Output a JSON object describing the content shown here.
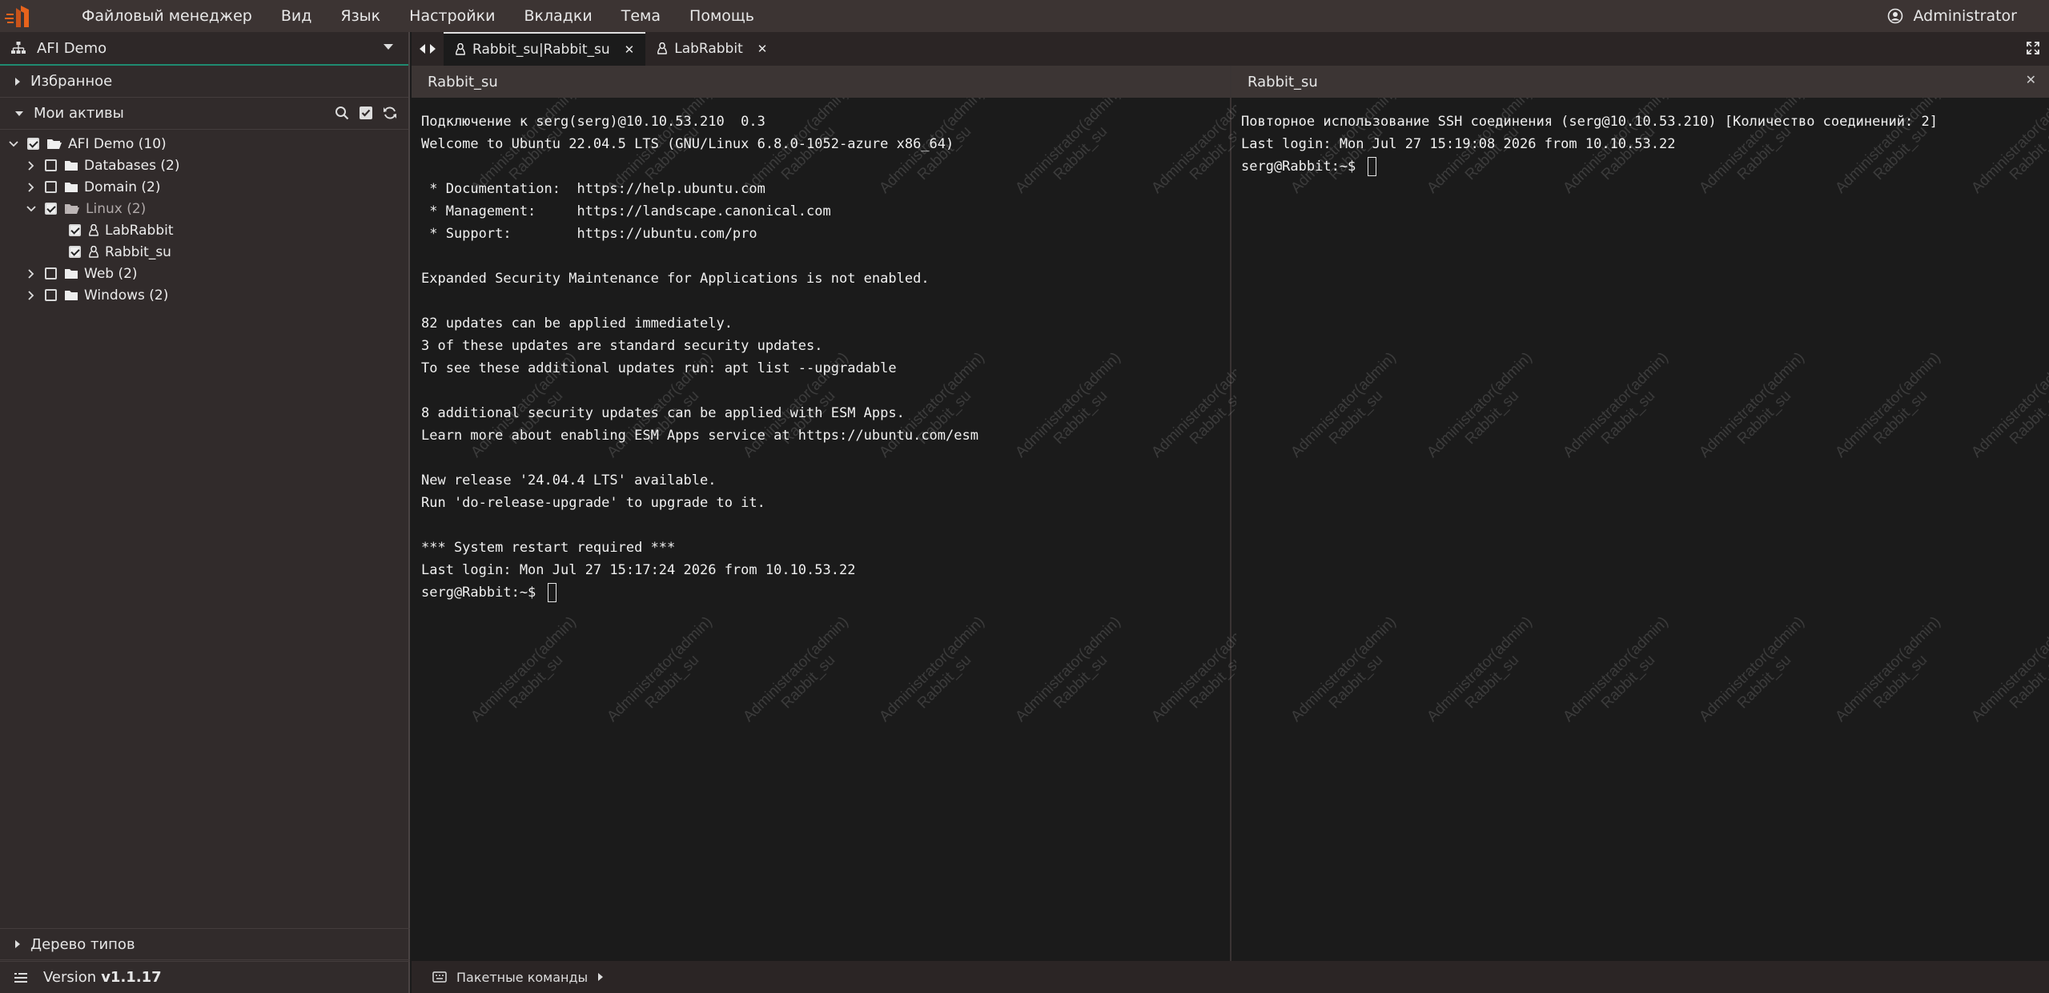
{
  "menubar": {
    "items": [
      "Файловый менеджер",
      "Вид",
      "Язык",
      "Настройки",
      "Вкладки",
      "Тема",
      "Помощь"
    ],
    "user": "Administrator",
    "accent": "#e8631c"
  },
  "sidebar": {
    "selector": "AFI Demo",
    "favorites": "Избранное",
    "assets": "Мои активы",
    "tree": {
      "root": "AFI Demo (10)",
      "databases": "Databases (2)",
      "domain": "Domain (2)",
      "linux": "Linux (2)",
      "labrabbit": "LabRabbit",
      "rabbit_su": "Rabbit_su",
      "web": "Web (2)",
      "windows": "Windows (2)"
    },
    "types": "Дерево типов",
    "version_label": "Version",
    "version_value": "v1.1.17"
  },
  "tabs": {
    "active": "Rabbit_su|Rabbit_su",
    "second": "LabRabbit"
  },
  "panes": {
    "left_title": "Rabbit_su",
    "right_title": "Rabbit_su"
  },
  "terminal_left": [
    "Подключение к serg(serg)@10.10.53.210  0.3",
    "Welcome to Ubuntu 22.04.5 LTS (GNU/Linux 6.8.0-1052-azure x86_64)",
    "",
    " * Documentation:  https://help.ubuntu.com",
    " * Management:     https://landscape.canonical.com",
    " * Support:        https://ubuntu.com/pro",
    "",
    "Expanded Security Maintenance for Applications is not enabled.",
    "",
    "82 updates can be applied immediately.",
    "3 of these updates are standard security updates.",
    "To see these additional updates run: apt list --upgradable",
    "",
    "8 additional security updates can be applied with ESM Apps.",
    "Learn more about enabling ESM Apps service at https://ubuntu.com/esm",
    "",
    "New release '24.04.4 LTS' available.",
    "Run 'do-release-upgrade' to upgrade to it.",
    "",
    "*** System restart required ***",
    "Last login: Mon Jul 27 15:17:24 2026 from 10.10.53.22",
    "serg@Rabbit:~$ "
  ],
  "terminal_right": [
    "Повторное использование SSH соединения (serg@10.10.53.210) [Количество соединений: 2]",
    "Last login: Mon Jul 27 15:19:08 2026 from 10.10.53.22",
    "serg@Rabbit:~$ "
  ],
  "watermark": "Administrator(admin)\nRabbit_su",
  "statusbar": {
    "batch": "Пакетные команды"
  }
}
